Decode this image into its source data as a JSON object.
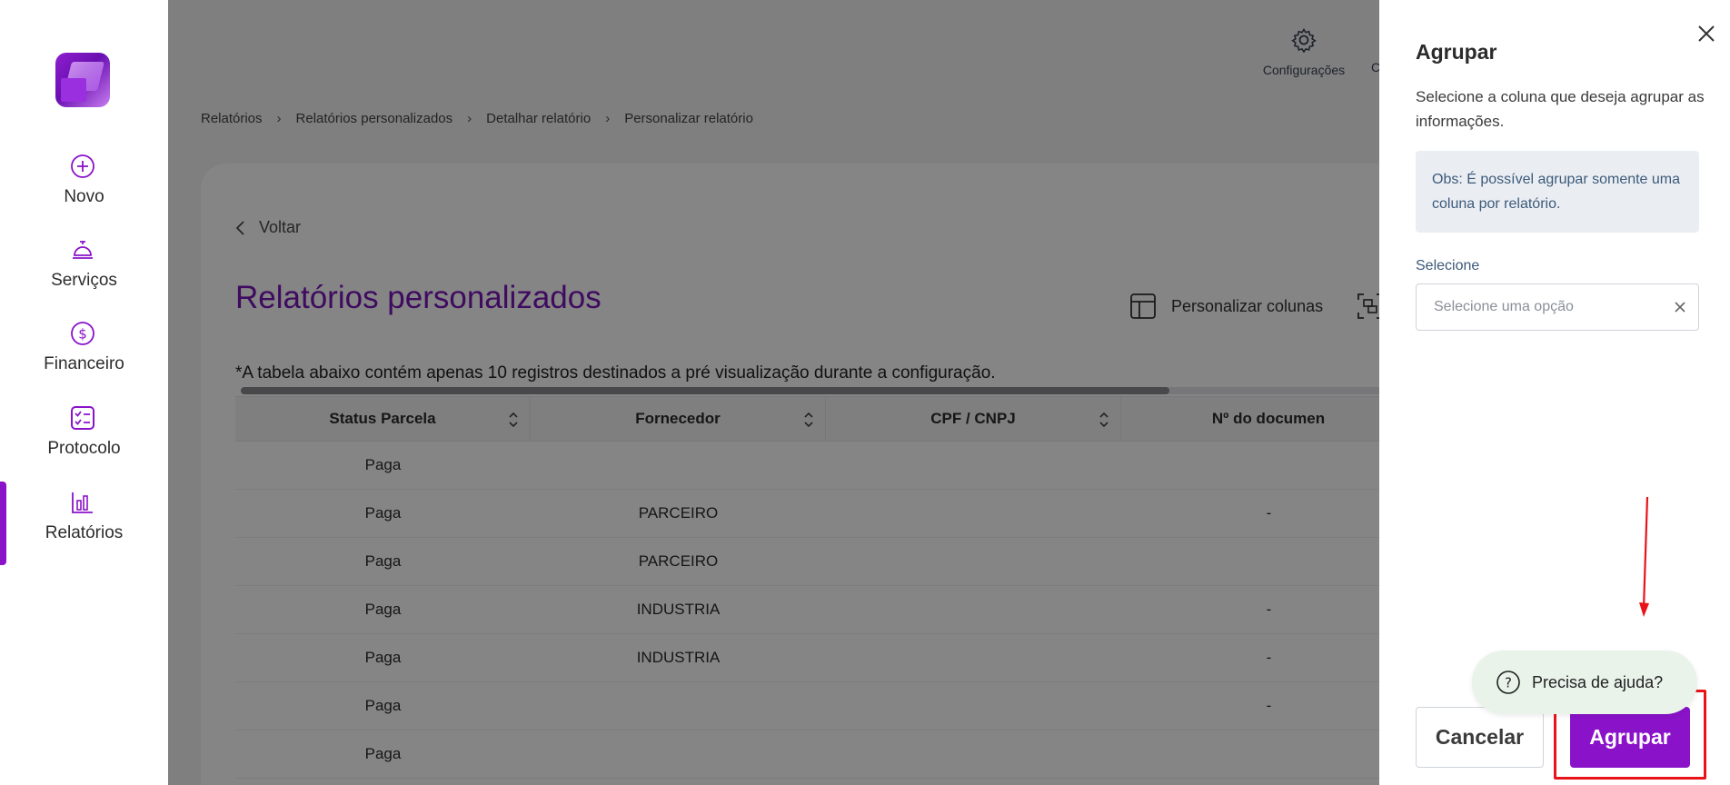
{
  "sidebar": {
    "items": [
      {
        "label": "Novo",
        "icon": "plus-circle-icon"
      },
      {
        "label": "Serviços",
        "icon": "service-bell-icon"
      },
      {
        "label": "Financeiro",
        "icon": "dollar-circle-icon"
      },
      {
        "label": "Protocolo",
        "icon": "checklist-icon"
      },
      {
        "label": "Relatórios",
        "icon": "bar-chart-icon"
      }
    ],
    "active": "Relatórios"
  },
  "topbar": {
    "config_label": "Configurações",
    "partial_label": "C"
  },
  "breadcrumb": [
    "Relatórios",
    "Relatórios personalizados",
    "Detalhar relatório",
    "Personalizar relatório"
  ],
  "main": {
    "back_label": "Voltar",
    "title": "Relatórios personalizados",
    "customize_columns_label": "Personalizar colunas",
    "note": "*A tabela abaixo contém apenas 10 registros destinados a pré visualização durante a configuração."
  },
  "table": {
    "columns": [
      "Status Parcela",
      "Fornecedor",
      "CPF / CNPJ",
      "Nº do documen"
    ],
    "rows": [
      [
        "Paga",
        "",
        "",
        ""
      ],
      [
        "Paga",
        "PARCEIRO",
        "",
        "-"
      ],
      [
        "Paga",
        "PARCEIRO",
        "",
        ""
      ],
      [
        "Paga",
        "INDUSTRIA",
        "",
        "-"
      ],
      [
        "Paga",
        "INDUSTRIA",
        "",
        "-"
      ],
      [
        "Paga",
        "",
        "",
        "-"
      ],
      [
        "Paga",
        "",
        "",
        ""
      ]
    ]
  },
  "drawer": {
    "title": "Agrupar",
    "description": "Selecione a coluna que deseja agrupar as informações.",
    "obs": "Obs: É possível agrupar somente uma coluna por relatório.",
    "select_label": "Selecione",
    "select_placeholder": "Selecione uma opção",
    "help_label": "Precisa de ajuda?",
    "cancel_label": "Cancelar",
    "confirm_label": "Agrupar"
  },
  "colors": {
    "brand": "#8a12c9",
    "title": "#7a16b8",
    "annotation": "#e8141a"
  }
}
